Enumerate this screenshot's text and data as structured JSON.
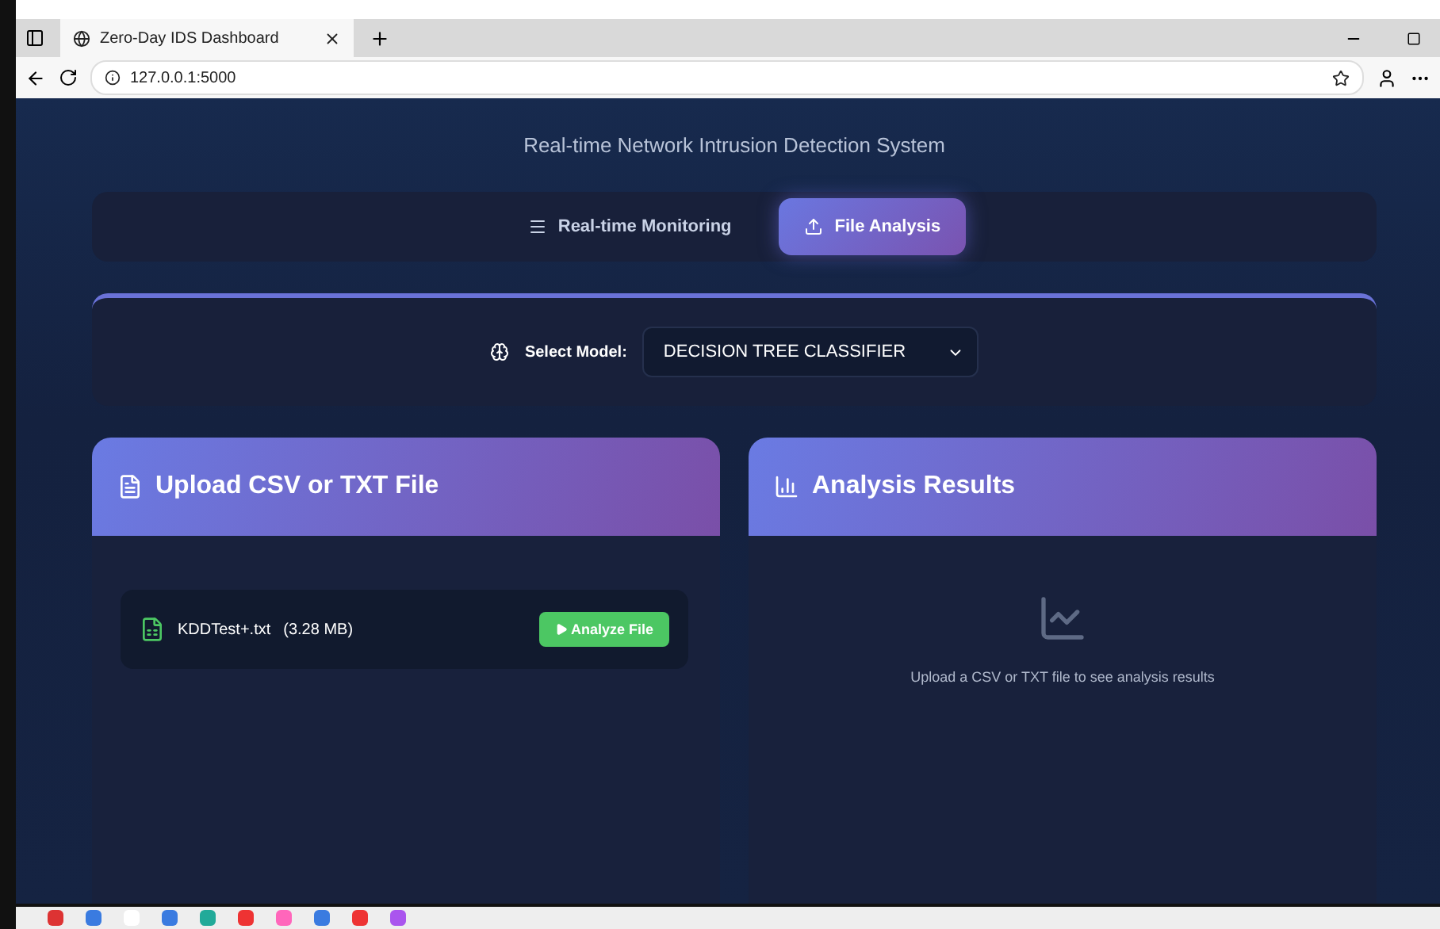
{
  "browser": {
    "tab_title": "Zero-Day IDS Dashboard",
    "address": "127.0.0.1:5000"
  },
  "subtitle": "Real-time Network Intrusion Detection System",
  "nav_tabs": [
    {
      "label": "Real-time Monitoring",
      "kind": "monitor",
      "selected": false
    },
    {
      "label": "File Analysis",
      "kind": "upload",
      "selected": true
    }
  ],
  "model": {
    "label": "Select Model:",
    "value": "DECISION TREE CLASSIFIER"
  },
  "upload_card": {
    "title": "Upload CSV or TXT File",
    "file_name": "KDDTest+.txt",
    "file_size": "(3.28 MB)",
    "button": "Analyze File"
  },
  "results_card": {
    "title": "Analysis Results",
    "empty_message": "Upload a CSV or TXT file to see analysis results"
  }
}
